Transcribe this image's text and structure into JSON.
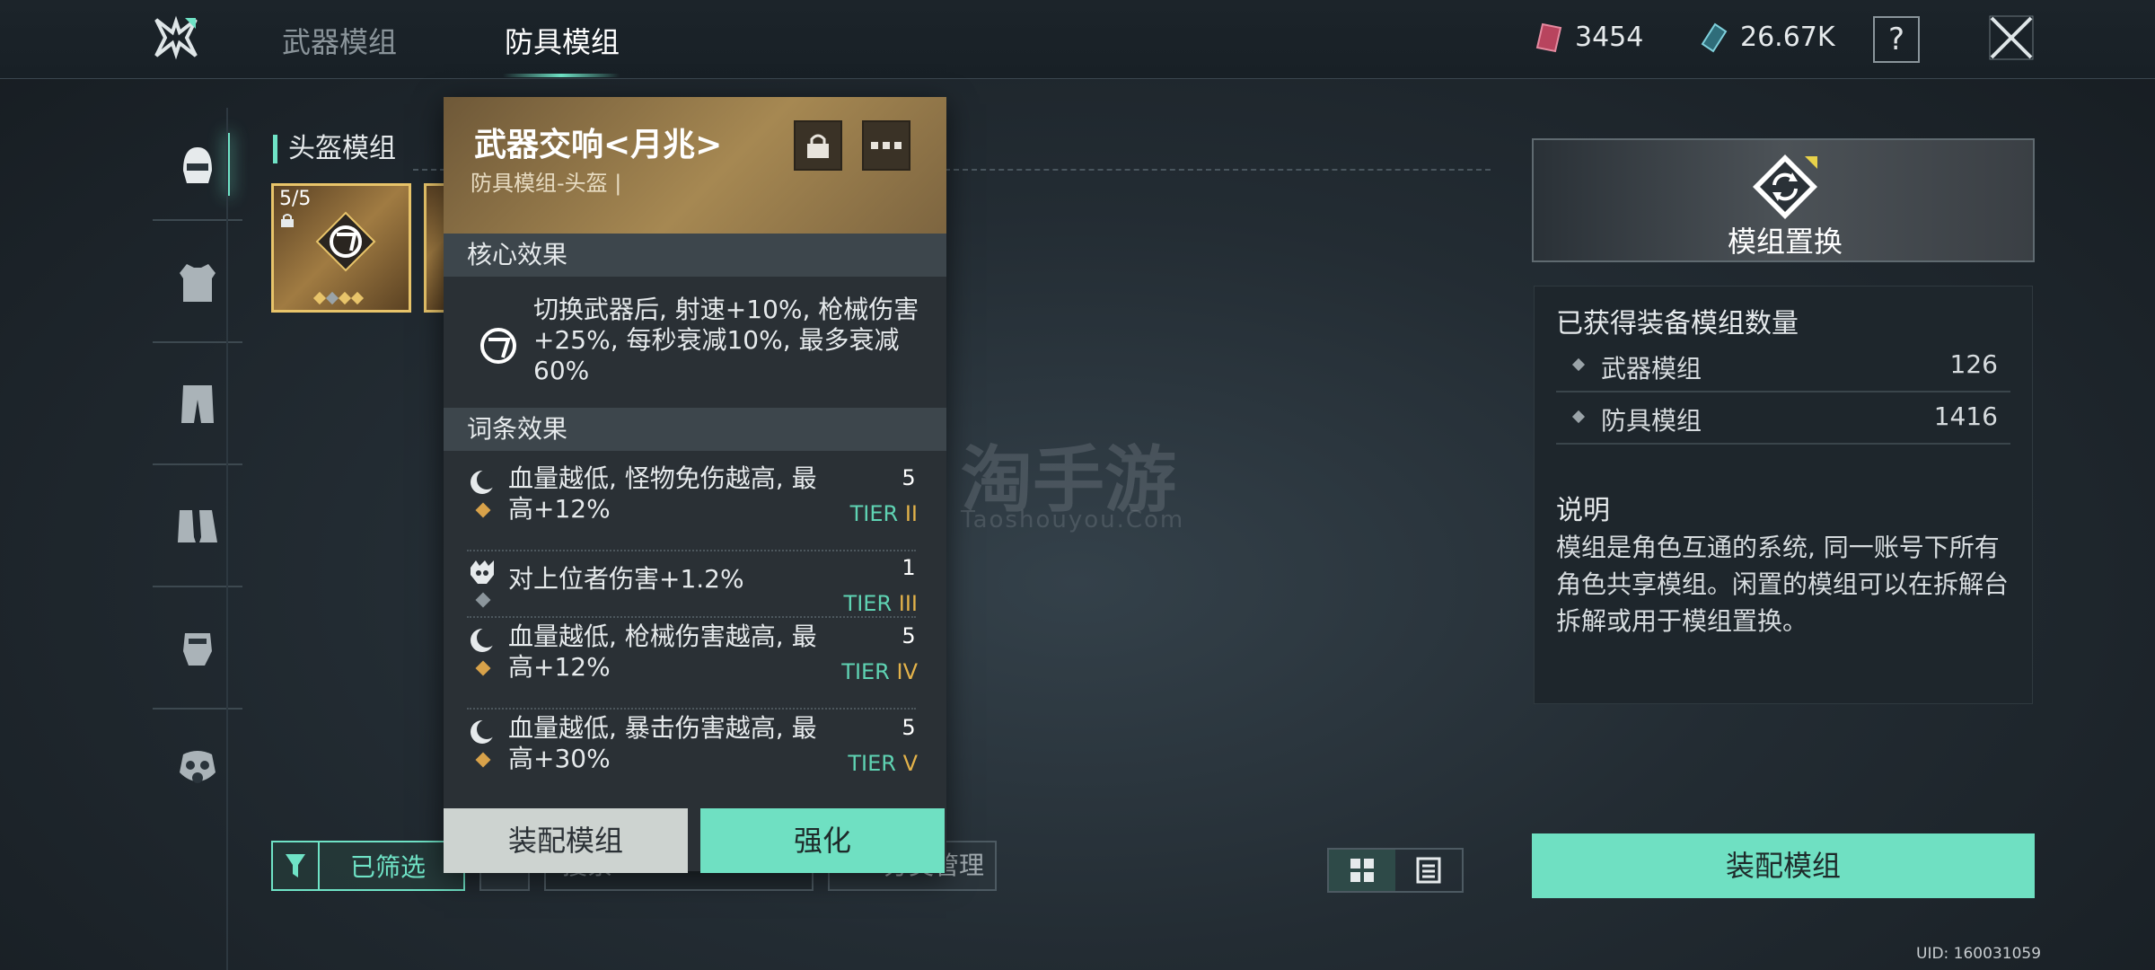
{
  "header": {
    "tabs": [
      {
        "label": "武器模组",
        "active": false
      },
      {
        "label": "防具模组",
        "active": true
      }
    ],
    "currency_red": "3454",
    "currency_teal": "26.67K",
    "help_label": "?"
  },
  "sidebar": {
    "items": [
      {
        "name": "helmet-icon",
        "active": true
      },
      {
        "name": "armor-icon",
        "active": false
      },
      {
        "name": "pants-icon",
        "active": false
      },
      {
        "name": "boots-icon",
        "active": false
      },
      {
        "name": "gloves-icon",
        "active": false
      },
      {
        "name": "mask-icon",
        "active": false
      }
    ]
  },
  "list": {
    "section_title": "头盔模组",
    "card": {
      "count": "5/5"
    }
  },
  "controls": {
    "filter_label": "已筛选",
    "search_placeholder": "搜索",
    "manage_label": "分类管理"
  },
  "popup": {
    "title": "武器交响<月兆>",
    "subtitle": "防具模组-头盔 |",
    "core_header": "核心效果",
    "core_text": "切换武器后, 射速+10%, 枪械伤害+25%, 每秒衰减10%, 最多衰减60%",
    "affix_header": "词条效果",
    "affixes": [
      {
        "text": "血量越低, 怪物免伤越高, 最高+12%",
        "level": "5",
        "tier": "TIER",
        "roman": "II"
      },
      {
        "text": "对上位者伤害+1.2%",
        "level": "1",
        "tier": "TIER",
        "roman": "III"
      },
      {
        "text": "血量越低, 枪械伤害越高, 最高+12%",
        "level": "5",
        "tier": "TIER",
        "roman": "IV"
      },
      {
        "text": "血量越低, 暴击伤害越高, 最高+30%",
        "level": "5",
        "tier": "TIER",
        "roman": "V"
      }
    ],
    "equip_label": "装配模组",
    "enhance_label": "强化"
  },
  "watermark": {
    "main": "淘手游",
    "sub": "Taoshouyou.Com"
  },
  "right_panel": {
    "replace_label": "模组置换",
    "stats_header": "已获得装备模组数量",
    "stats": [
      {
        "name": "武器模组",
        "value": "126"
      },
      {
        "name": "防具模组",
        "value": "1416"
      }
    ],
    "desc_title": "说明",
    "desc_text": "模组是角色互通的系统, 同一账号下所有角色共享模组。闲置的模组可以在拆解台拆解或用于模组置换。",
    "equip_label": "装配模组"
  },
  "uid": "UID: 160031059",
  "colors": {
    "accent": "#6fe3c6",
    "gold": "#e8c46a",
    "tier_roman": "#e3b24a"
  }
}
